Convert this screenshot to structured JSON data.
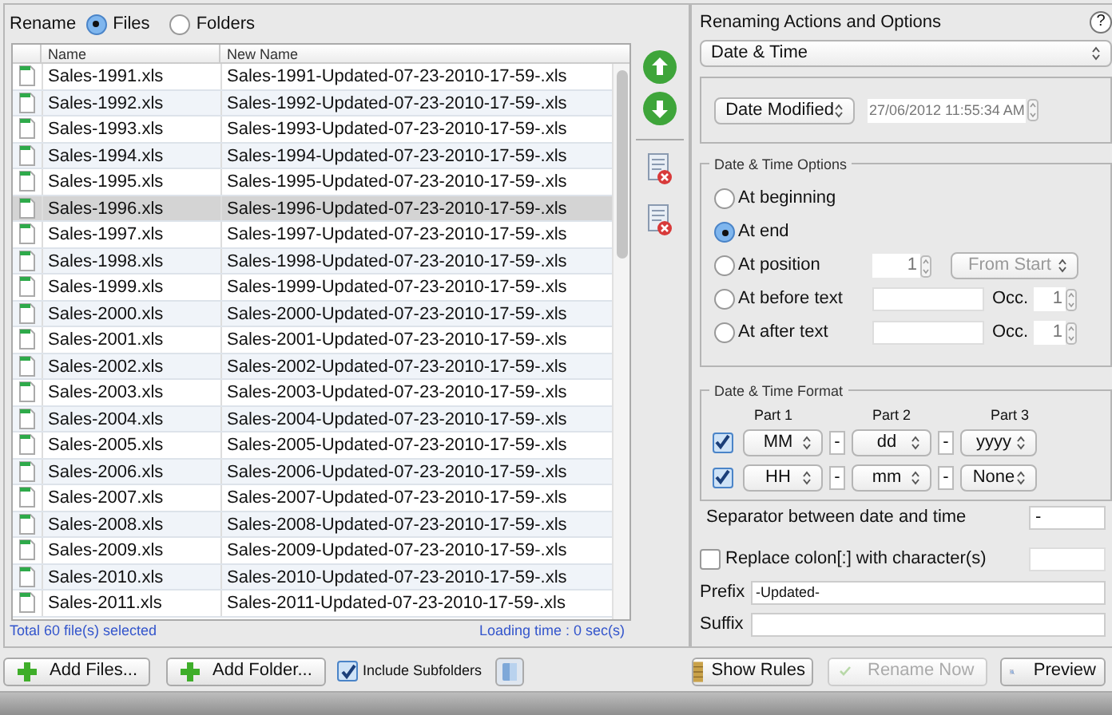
{
  "rename": {
    "label": "Rename",
    "options": [
      {
        "label": "Files",
        "selected": true
      },
      {
        "label": "Folders",
        "selected": false
      }
    ]
  },
  "table": {
    "columns": [
      "Name",
      "New Name"
    ],
    "rows": [
      {
        "name": "Sales-1991.xls",
        "new_name": "Sales-1991-Updated-07-23-2010-17-59-.xls",
        "selected": false
      },
      {
        "name": "Sales-1992.xls",
        "new_name": "Sales-1992-Updated-07-23-2010-17-59-.xls",
        "selected": false
      },
      {
        "name": "Sales-1993.xls",
        "new_name": "Sales-1993-Updated-07-23-2010-17-59-.xls",
        "selected": false
      },
      {
        "name": "Sales-1994.xls",
        "new_name": "Sales-1994-Updated-07-23-2010-17-59-.xls",
        "selected": false
      },
      {
        "name": "Sales-1995.xls",
        "new_name": "Sales-1995-Updated-07-23-2010-17-59-.xls",
        "selected": false
      },
      {
        "name": "Sales-1996.xls",
        "new_name": "Sales-1996-Updated-07-23-2010-17-59-.xls",
        "selected": true
      },
      {
        "name": "Sales-1997.xls",
        "new_name": "Sales-1997-Updated-07-23-2010-17-59-.xls",
        "selected": false
      },
      {
        "name": "Sales-1998.xls",
        "new_name": "Sales-1998-Updated-07-23-2010-17-59-.xls",
        "selected": false
      },
      {
        "name": "Sales-1999.xls",
        "new_name": "Sales-1999-Updated-07-23-2010-17-59-.xls",
        "selected": false
      },
      {
        "name": "Sales-2000.xls",
        "new_name": "Sales-2000-Updated-07-23-2010-17-59-.xls",
        "selected": false
      },
      {
        "name": "Sales-2001.xls",
        "new_name": "Sales-2001-Updated-07-23-2010-17-59-.xls",
        "selected": false
      },
      {
        "name": "Sales-2002.xls",
        "new_name": "Sales-2002-Updated-07-23-2010-17-59-.xls",
        "selected": false
      },
      {
        "name": "Sales-2003.xls",
        "new_name": "Sales-2003-Updated-07-23-2010-17-59-.xls",
        "selected": false
      },
      {
        "name": "Sales-2004.xls",
        "new_name": "Sales-2004-Updated-07-23-2010-17-59-.xls",
        "selected": false
      },
      {
        "name": "Sales-2005.xls",
        "new_name": "Sales-2005-Updated-07-23-2010-17-59-.xls",
        "selected": false
      },
      {
        "name": "Sales-2006.xls",
        "new_name": "Sales-2006-Updated-07-23-2010-17-59-.xls",
        "selected": false
      },
      {
        "name": "Sales-2007.xls",
        "new_name": "Sales-2007-Updated-07-23-2010-17-59-.xls",
        "selected": false
      },
      {
        "name": "Sales-2008.xls",
        "new_name": "Sales-2008-Updated-07-23-2010-17-59-.xls",
        "selected": false
      },
      {
        "name": "Sales-2009.xls",
        "new_name": "Sales-2009-Updated-07-23-2010-17-59-.xls",
        "selected": false
      },
      {
        "name": "Sales-2010.xls",
        "new_name": "Sales-2010-Updated-07-23-2010-17-59-.xls",
        "selected": false
      },
      {
        "name": "Sales-2011.xls",
        "new_name": "Sales-2011-Updated-07-23-2010-17-59-.xls",
        "selected": false
      }
    ]
  },
  "status": {
    "selected": "Total 60 file(s) selected",
    "loading": "Loading time : 0 sec(s)"
  },
  "options": {
    "title": "Renaming Actions and Options",
    "help": "?",
    "action": "Date & Time",
    "date_source": "Date Modified",
    "date_value": "27/06/2012 11:55:34 AM",
    "positions_title": "Date & Time Options",
    "positions": [
      {
        "kind": "plain",
        "label": "At beginning",
        "selected": false
      },
      {
        "kind": "plain",
        "label": "At end",
        "selected": true
      },
      {
        "kind": "position",
        "label": "At position",
        "selected": false,
        "value": "1",
        "from": "From Start"
      },
      {
        "kind": "text",
        "label": "At before text",
        "selected": false,
        "occ_label": "Occ.",
        "occ": "1"
      },
      {
        "kind": "text",
        "label": "At after text",
        "selected": false,
        "occ_label": "Occ.",
        "occ": "1"
      }
    ],
    "format_title": "Date & Time Format",
    "part_labels": [
      "Part 1",
      "Part 2",
      "Part 3"
    ],
    "format_rows": [
      {
        "checked": true,
        "parts": [
          "MM",
          "dd",
          "yyyy"
        ],
        "separators": [
          "-",
          "-"
        ]
      },
      {
        "checked": true,
        "parts": [
          "HH",
          "mm",
          "None"
        ],
        "separators": [
          "-",
          "-"
        ]
      }
    ],
    "separator_label": "Separator between date and time",
    "separator_value": "-",
    "replace_colon": {
      "label": "Replace colon[:] with character(s)",
      "checked": false
    },
    "prefix": {
      "label": "Prefix",
      "value": "-Updated-"
    },
    "suffix": {
      "label": "Suffix"
    }
  },
  "bottom": {
    "add_files": "Add Files...",
    "add_folder": "Add Folder...",
    "include_subfolders": {
      "label": "Include Subfolders",
      "checked": true
    },
    "show_rules": "Show Rules",
    "rename_now": {
      "label": "Rename Now",
      "disabled": true
    },
    "preview": "Preview"
  }
}
